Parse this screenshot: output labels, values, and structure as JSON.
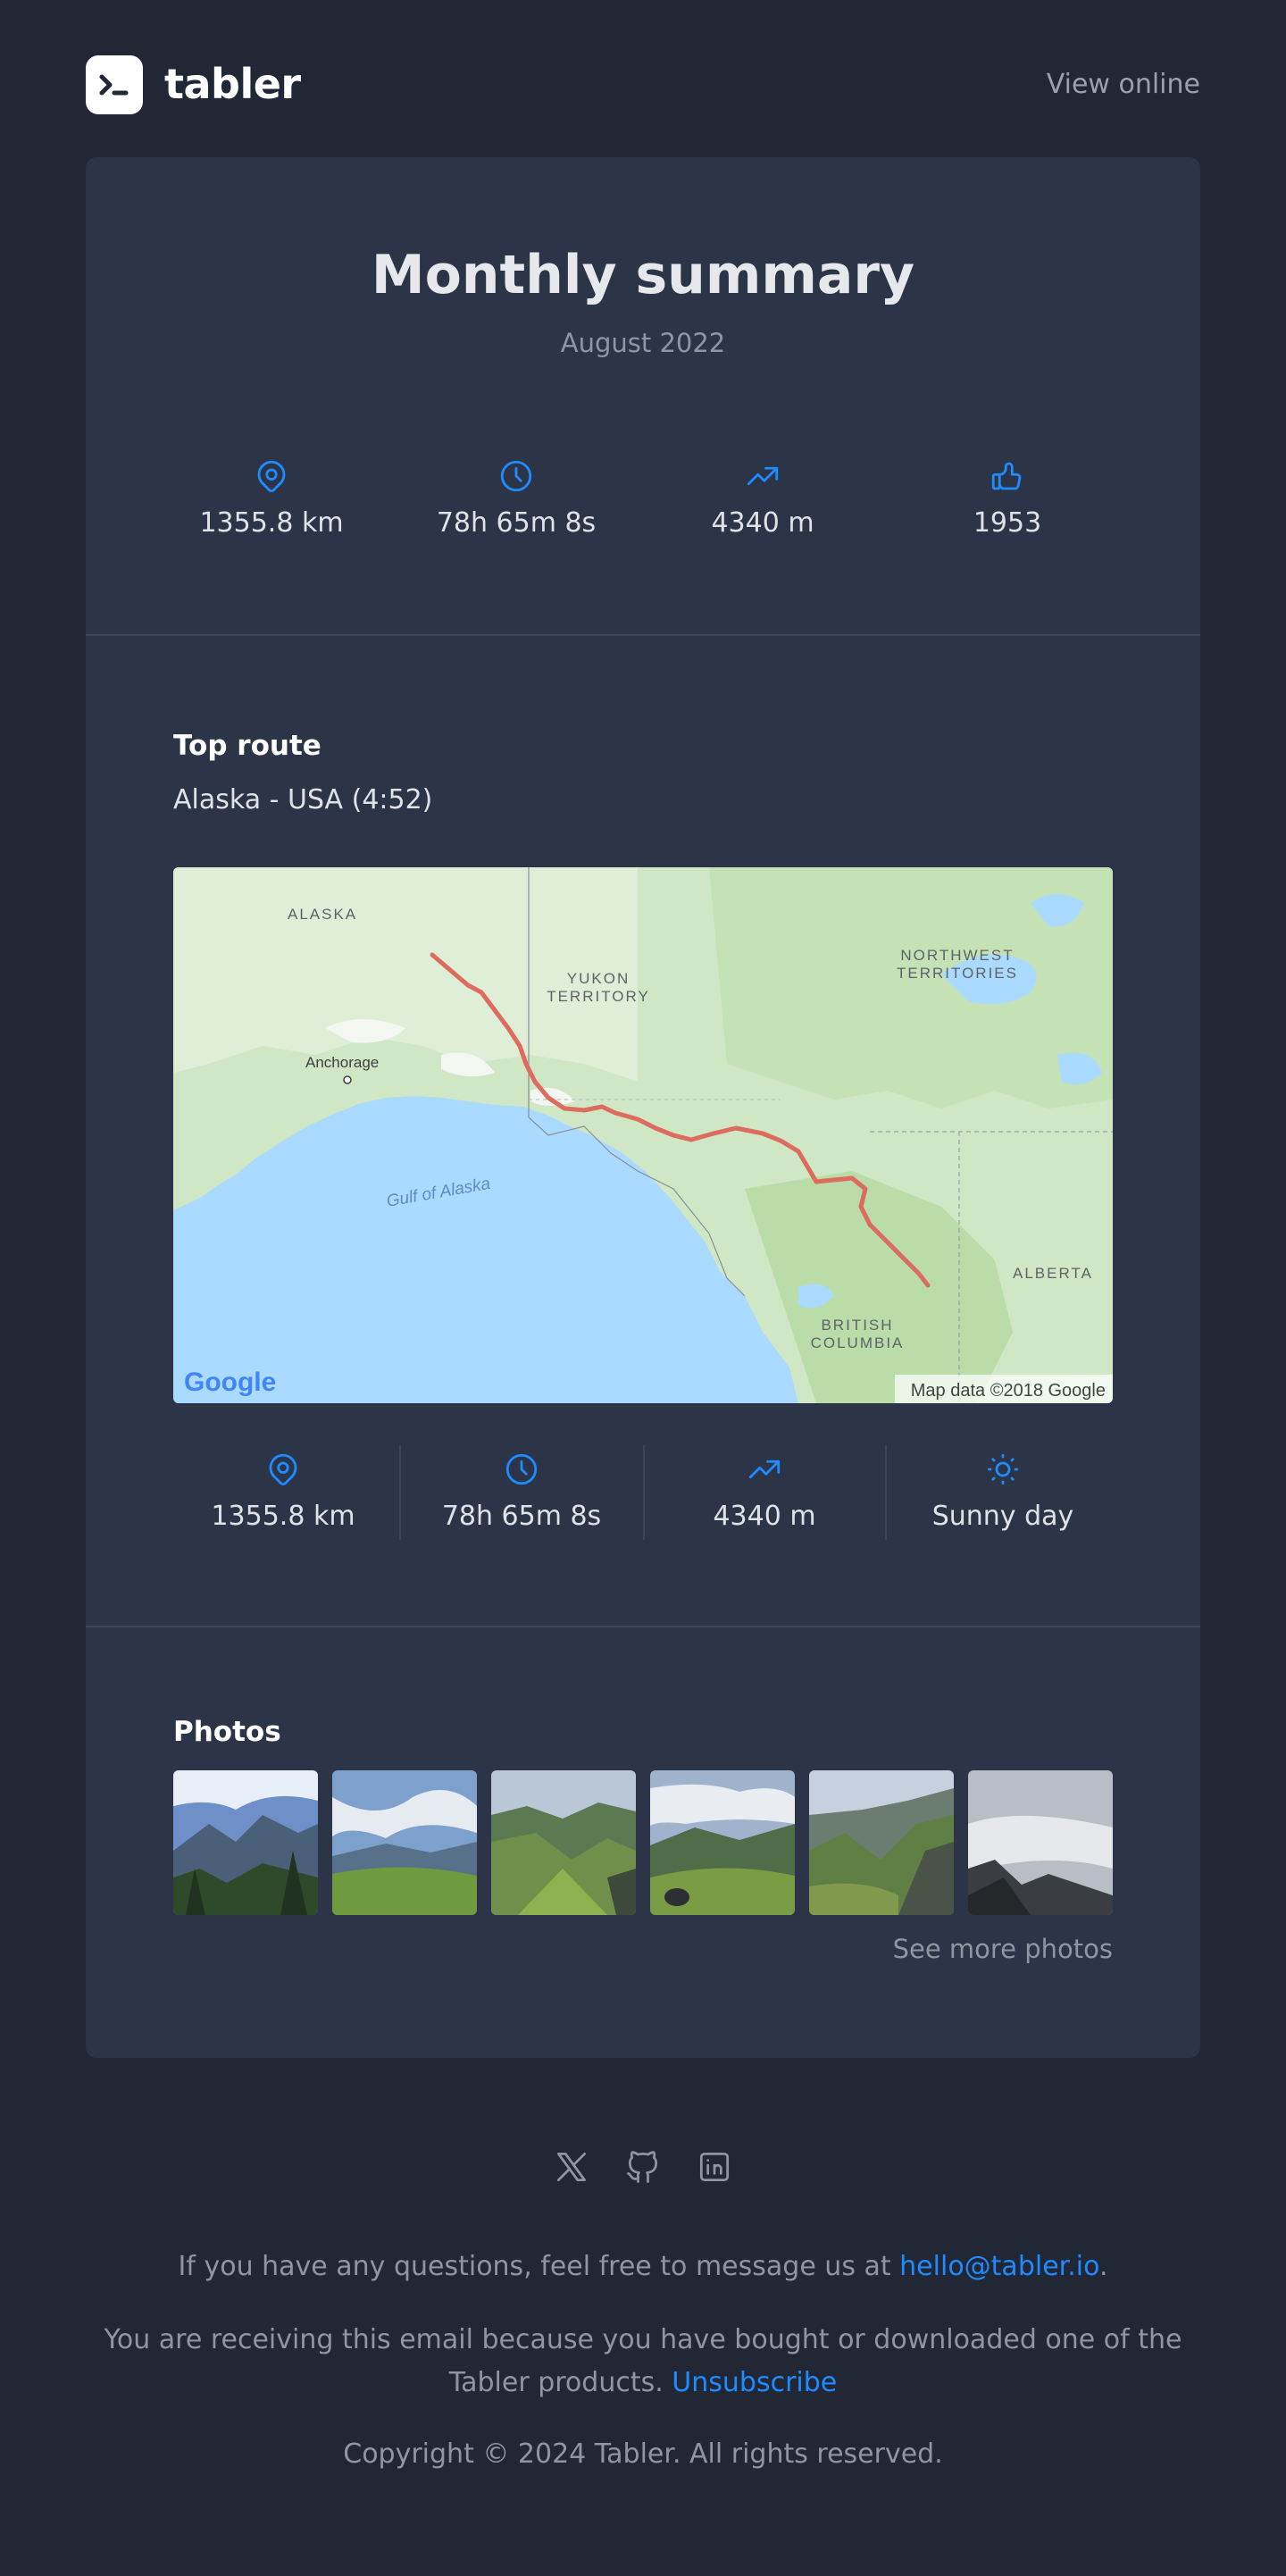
{
  "brand": {
    "name": "tabler",
    "view_online": "View online"
  },
  "summary": {
    "title": "Monthly summary",
    "period": "August 2022",
    "stats": [
      {
        "icon": "map-pin-icon",
        "value": "1355.8 km"
      },
      {
        "icon": "clock-icon",
        "value": "78h 65m 8s"
      },
      {
        "icon": "trending-up-icon",
        "value": "4340 m"
      },
      {
        "icon": "thumb-up-icon",
        "value": "1953"
      }
    ]
  },
  "top_route": {
    "heading": "Top route",
    "route": "Alaska - USA (4:52)",
    "map": {
      "labels": {
        "alaska": "ALASKA",
        "yukon_1": "YUKON",
        "yukon_2": "TERRITORY",
        "nwt_1": "NORTHWEST",
        "nwt_2": "TERRITORIES",
        "anchorage": "Anchorage",
        "gulf": "Gulf of Alaska",
        "alberta": "ALBERTA",
        "bc_1": "BRITISH",
        "bc_2": "COLUMBIA",
        "google": "Google",
        "attribution": "Map data ©2018 Google"
      },
      "route_color": "#dd6b5e"
    },
    "stats": [
      {
        "icon": "map-pin-icon",
        "value": "1355.8 km"
      },
      {
        "icon": "clock-icon",
        "value": "78h 65m 8s"
      },
      {
        "icon": "trending-up-icon",
        "value": "4340 m"
      },
      {
        "icon": "sun-icon",
        "value": "Sunny day"
      }
    ]
  },
  "photos": {
    "heading": "Photos",
    "see_more": "See more photos"
  },
  "footer": {
    "socials": [
      "x-icon",
      "github-icon",
      "linkedin-icon"
    ],
    "questions_prefix": "If you have any questions, feel free to message us at ",
    "email": "hello@tabler.io",
    "questions_suffix": ".",
    "receiving_text": "You are receiving this email because you have bought or downloaded one of the Tabler products. ",
    "unsubscribe": "Unsubscribe",
    "copyright": "Copyright © 2024 Tabler. All rights reserved."
  },
  "colors": {
    "accent": "#1f8bff",
    "background": "#212735",
    "card": "#2c3547"
  }
}
